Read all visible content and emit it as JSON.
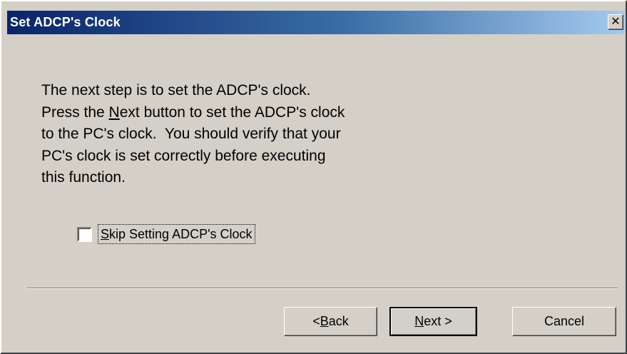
{
  "window": {
    "title": "Set ADCP's Clock",
    "close_glyph": "✕"
  },
  "message": {
    "line1": "The next step is to set the ADCP's clock.",
    "line2_pre": "Press the ",
    "line2_mnemonic": "N",
    "line2_post": "ext button to set the ADCP's clock",
    "line3": "to the PC's clock.  You should verify that your",
    "line4": "PC's clock is set correctly before executing",
    "line5": "this function."
  },
  "checkbox": {
    "mnemonic": "S",
    "label_rest": "kip Setting ADCP's Clock",
    "checked": false
  },
  "buttons": {
    "back_prefix": "< ",
    "back_mnemonic": "B",
    "back_rest": "ack",
    "next_mnemonic": "N",
    "next_rest": "ext >",
    "cancel": "Cancel"
  },
  "icons": {
    "close": "close-icon"
  },
  "colors": {
    "title_gradient_start": "#0a246a",
    "title_gradient_end": "#a6caf0",
    "dialog_face": "#d4d0c8"
  }
}
